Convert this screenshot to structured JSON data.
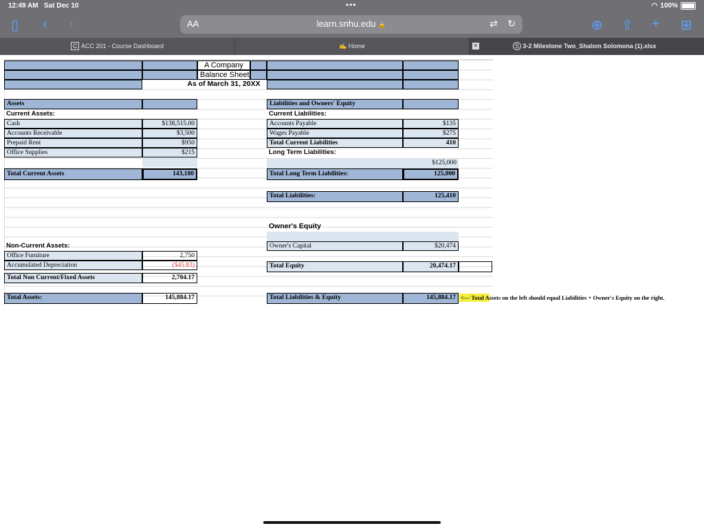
{
  "status": {
    "time": "12:49 AM",
    "date": "Sat Dec 10",
    "battery": "100%"
  },
  "browser": {
    "aa": "AA",
    "url": "learn.snhu.edu",
    "lock": "🔒"
  },
  "tabs": [
    {
      "label": "ACC 201 - Course Dashboard",
      "icon": "C"
    },
    {
      "label": "Home",
      "icon": "✍"
    },
    {
      "label": "3-2 Milestone Two_Shalom Solomona (1).xlsx",
      "icon": "S"
    }
  ],
  "sheet": {
    "company": "A Company",
    "title": "Balance Sheet",
    "date": "As of March 31, 20XX",
    "assets_header": "Assets",
    "current_assets": "Current Assets:",
    "cash": "Cash",
    "cash_val": "$138,515.00",
    "ar": "Accounts Receivable",
    "ar_val": "$3,500",
    "prepaid": "Prepaid Rent",
    "prepaid_val": "$950",
    "supplies": "Office Supplies",
    "supplies_val": "$215",
    "tca": "Total Current Assets",
    "tca_val": "143,180",
    "nca": "Non-Current Assets:",
    "furn": "Office Furniture",
    "furn_val": "2,750",
    "dep": "Accumulated Depreciation",
    "dep_val": "($45.83)",
    "tnca": "Total Non Current/Fixed Assets",
    "tnca_val": "2,704.17",
    "ta": "Total Assets:",
    "ta_val": "145,884.17",
    "liab_header": "Liabilities and Owners' Equity",
    "cl": "Current Liabilities:",
    "ap": "Accounts Payable",
    "ap_val": "$135",
    "wp": "Wages Payable",
    "wp_val": "$275",
    "tcl": "Total Current Liabilities",
    "tcl_val": "410",
    "ltl": "Long Term Liabilities:",
    "ltl_val": "$125,000",
    "tltl": "Total Long Term Liabilities:",
    "tltl_val": "125,000",
    "tl": "Total Liabilities:",
    "tl_val": "125,410",
    "oe": "Owner's Equity",
    "oc": "Owner's Capital",
    "oc_val": "$20,474",
    "te": "Total Equity",
    "te_val": "20,474.17",
    "tle": "Total Liabilities & Equity",
    "tle_val": "145,884.17",
    "note_arrow": "<---",
    "note_hl": "Total A",
    "note_rest": "ssets on the left should equal Liabilities + Owner's Equity on the right."
  }
}
